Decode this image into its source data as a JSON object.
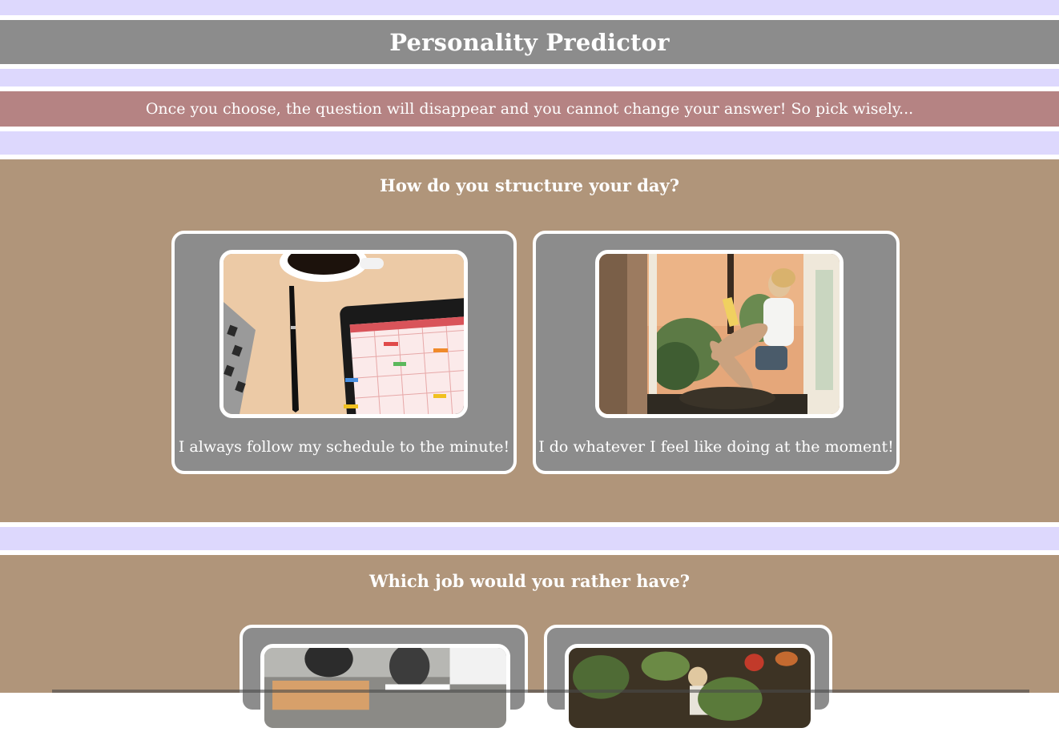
{
  "header": {
    "title": "Personality Predictor"
  },
  "notice": {
    "text": "Once you choose, the question will disappear and you cannot change your answer! So pick wisely..."
  },
  "questions": [
    {
      "text": "How do you structure your day?",
      "options": [
        {
          "label": "I always follow my schedule to the minute!",
          "image": "desk-calendar-photo"
        },
        {
          "label": "I do whatever I feel like doing at the moment!",
          "image": "woman-reading-window-photo"
        }
      ]
    },
    {
      "text": "Which job would you rather have?",
      "options": [
        {
          "label": "",
          "image": "office-meeting-photo"
        },
        {
          "label": "",
          "image": "plant-shop-photo"
        }
      ]
    }
  ],
  "colors": {
    "lavender": "#ddd8fd",
    "header_gray": "#8c8c8c",
    "notice_rose": "#b58383",
    "section_tan": "#b0957a",
    "card_gray": "#8c8c8c"
  }
}
